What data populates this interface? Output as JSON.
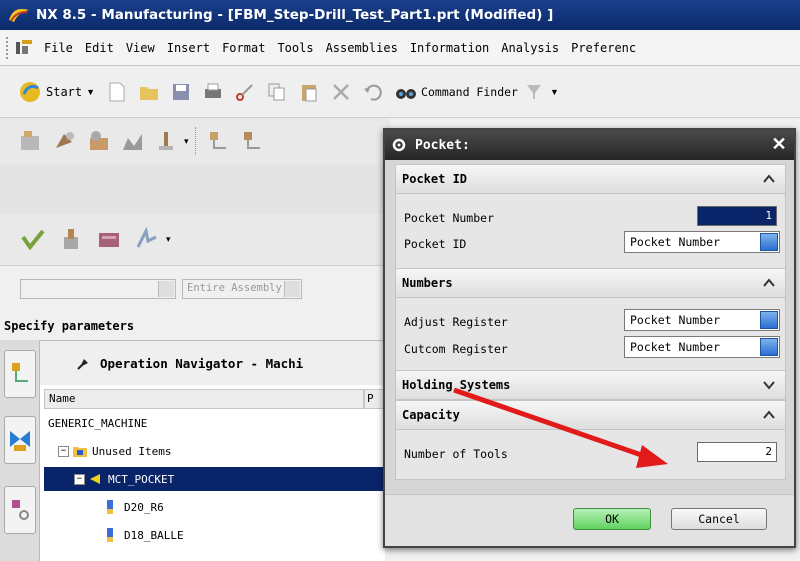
{
  "window": {
    "title": "NX 8.5 - Manufacturing - [FBM_Step-Drill_Test_Part1.prt (Modified) ]"
  },
  "menu": [
    {
      "label": "File"
    },
    {
      "label": "Edit"
    },
    {
      "label": "View"
    },
    {
      "label": "Insert"
    },
    {
      "label": "Format"
    },
    {
      "label": "Tools"
    },
    {
      "label": "Assemblies"
    },
    {
      "label": "Information"
    },
    {
      "label": "Analysis"
    },
    {
      "label": "Preferenc"
    }
  ],
  "toolbar": {
    "start_label": "Start",
    "command_finder_label": "Command Finder"
  },
  "selection_bar": {
    "scope": "Entire Assembly"
  },
  "status": {
    "prompt": "Specify parameters"
  },
  "navigator": {
    "title": "Operation Navigator - Machi",
    "columns": {
      "name": "Name",
      "p": "P"
    },
    "rows": [
      {
        "label": "GENERIC_MACHINE"
      },
      {
        "label": "Unused Items"
      },
      {
        "label": "MCT_POCKET"
      },
      {
        "label": "D20_R6"
      },
      {
        "label": "D18_BALLE"
      }
    ]
  },
  "dialog": {
    "title": "Pocket:",
    "sections": {
      "pocket_id": {
        "title": "Pocket ID",
        "pocket_number_label": "Pocket Number",
        "pocket_number_value": "1",
        "pocket_id_label": "Pocket ID",
        "pocket_id_value": "Pocket Number"
      },
      "numbers": {
        "title": "Numbers",
        "adjust_register_label": "Adjust Register",
        "adjust_register_value": "Pocket Number",
        "cutcom_register_label": "Cutcom Register",
        "cutcom_register_value": "Pocket Number"
      },
      "holding_systems": {
        "title": "Holding Systems"
      },
      "capacity": {
        "title": "Capacity",
        "number_of_tools_label": "Number of Tools",
        "number_of_tools_value": "2"
      }
    },
    "ok_label": "OK",
    "cancel_label": "Cancel"
  },
  "colors": {
    "selection": "#0a246a",
    "annotation_arrow": "#e21a1a",
    "ok_button": "#5fd35f"
  }
}
